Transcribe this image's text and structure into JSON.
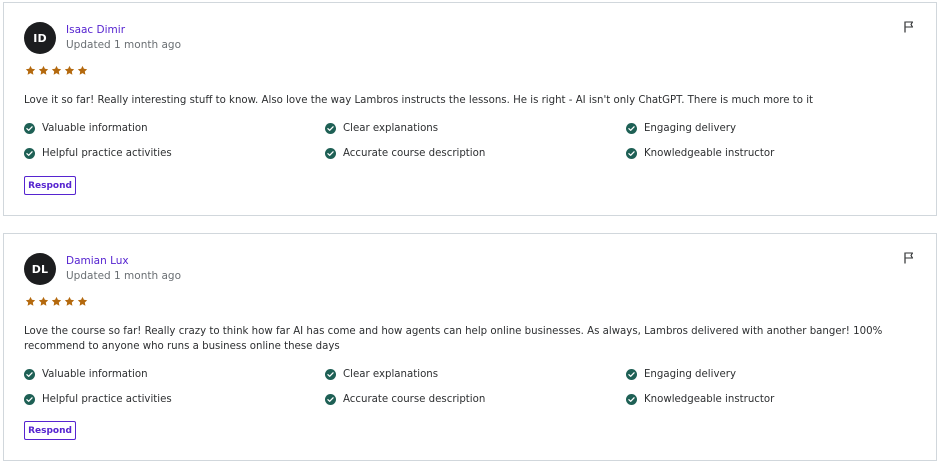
{
  "colors": {
    "accent": "#5624d0",
    "star": "#b4690e",
    "check": "#1e6055",
    "avatar_bg": "#1c1d1f",
    "border": "#d1d7dc"
  },
  "icons": {
    "flag": "flag-icon",
    "star": "star-icon",
    "check": "check-circle-icon"
  },
  "reviews": [
    {
      "initials": "ID",
      "name": "Isaac Dimir",
      "updated": "Updated 1 month ago",
      "rating": 5,
      "text": "Love it so far! Really interesting stuff to know. Also love the way Lambros instructs the lessons. He is right - AI isn't only ChatGPT. There is much more to it",
      "features": [
        "Valuable information",
        "Clear explanations",
        "Engaging delivery",
        "Helpful practice activities",
        "Accurate course description",
        "Knowledgeable instructor"
      ],
      "respond_label": "Respond"
    },
    {
      "initials": "DL",
      "name": "Damian Lux",
      "updated": "Updated 1 month ago",
      "rating": 5,
      "text": "Love the course so far! Really crazy to think how far AI has come and how agents can help online businesses. As always, Lambros delivered with another banger! 100% recommend to anyone who runs a business online these days",
      "features": [
        "Valuable information",
        "Clear explanations",
        "Engaging delivery",
        "Helpful practice activities",
        "Accurate course description",
        "Knowledgeable instructor"
      ],
      "respond_label": "Respond"
    }
  ]
}
